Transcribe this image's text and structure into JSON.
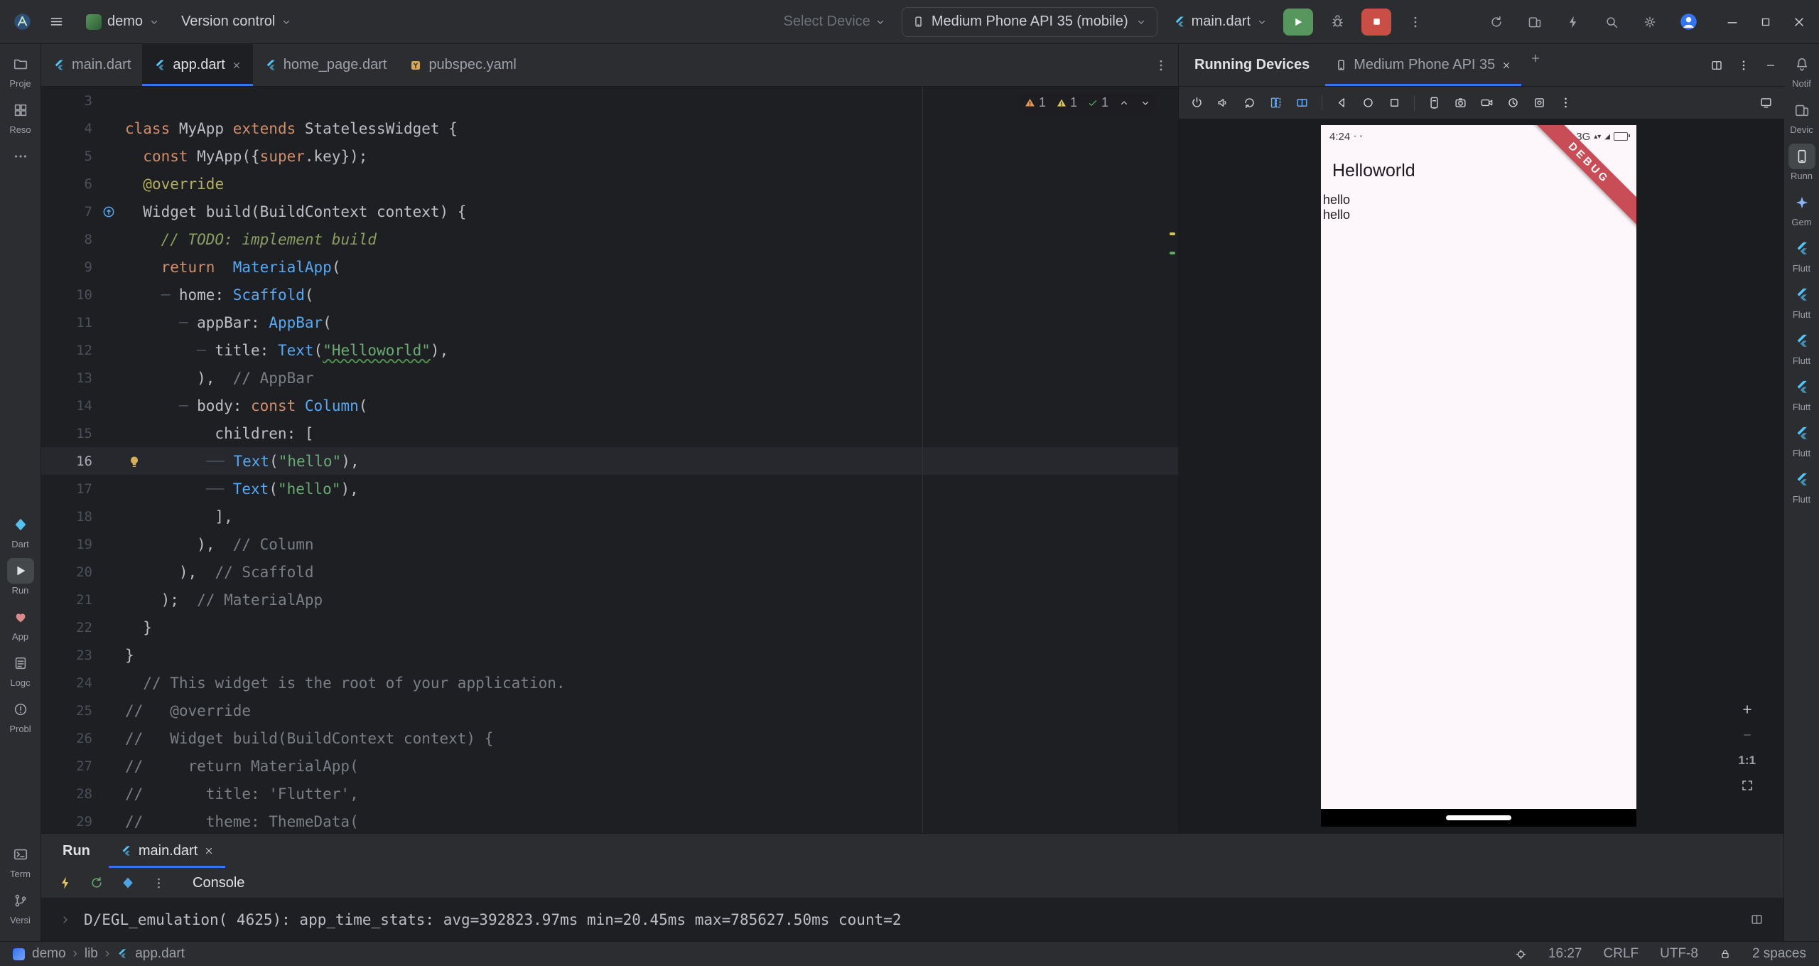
{
  "colors": {
    "accent": "#3574F0",
    "editor_bg": "#1E1F22",
    "panel_bg": "#2B2D30",
    "text": "#BCBEC4",
    "dim_text": "#9DA0A8",
    "run_green": "#57965C",
    "stop_red": "#C94F46",
    "keyword_orange": "#CF8E6D",
    "type_blue": "#56A8F5",
    "string_green": "#6AAB73",
    "comment_grey": "#7A7E85",
    "todo_green": "#8C9E62",
    "annotation_yellow": "#B3AE60",
    "guide_grey": "#494F57",
    "current_line": "#26282E",
    "phone_bg": "#FDF6FA",
    "phone_text": "#1D1B20",
    "banner_red": "#C6414B",
    "flutter_blue": "#54C5F8",
    "warning_amber": "#E3985C",
    "warning_yellow": "#D9C35A",
    "ok_green": "#5FAD65"
  },
  "title_bar": {
    "project": "demo",
    "vcs": "Version control",
    "select_device": "Select Device",
    "device": "Medium Phone API 35 (mobile)",
    "run_config": "main.dart"
  },
  "left_strip": {
    "groups": [
      [
        {
          "id": "project",
          "icon": "folder",
          "label": "Proje"
        },
        {
          "id": "resource-manager",
          "icon": "grid",
          "label": "Reso"
        },
        {
          "id": "more-tool-windows",
          "icon": "more-h",
          "label": ""
        }
      ],
      [
        {
          "id": "dart-analysis",
          "icon": "dart",
          "label": "Dart",
          "color": "#55c1f0"
        },
        {
          "id": "run",
          "icon": "play",
          "label": "Run",
          "selected": true
        },
        {
          "id": "app-quality-insights",
          "icon": "heart",
          "label": "App",
          "color": "#d98a8a"
        },
        {
          "id": "logcat",
          "icon": "logdoc",
          "label": "Logc"
        },
        {
          "id": "problems",
          "icon": "warning-circle",
          "label": "Probl"
        }
      ],
      [
        {
          "id": "terminal",
          "icon": "terminal",
          "label": "Term"
        },
        {
          "id": "version-control",
          "icon": "branch",
          "label": "Versi"
        }
      ]
    ]
  },
  "right_strip": {
    "groups": [
      [
        {
          "id": "notifications",
          "icon": "bell",
          "label": "Notif"
        },
        {
          "id": "device-manager",
          "icon": "devices",
          "label": "Devic"
        },
        {
          "id": "running-devices",
          "icon": "phone",
          "label": "Runn",
          "selected": true
        },
        {
          "id": "gemini",
          "icon": "star4",
          "label": "Gem",
          "color": "#8ab4f8"
        },
        {
          "id": "flutter-tool-1",
          "icon": "flutter",
          "label": "Flutt",
          "color": "#54c5f8"
        },
        {
          "id": "flutter-tool-2",
          "icon": "flutter",
          "label": "Flutt",
          "color": "#54c5f8"
        },
        {
          "id": "flutter-tool-3",
          "icon": "flutter",
          "label": "Flutt",
          "color": "#54c5f8"
        },
        {
          "id": "flutter-tool-4",
          "icon": "flutter",
          "label": "Flutt",
          "color": "#54c5f8"
        },
        {
          "id": "flutter-tool-5",
          "icon": "flutter",
          "label": "Flutt",
          "color": "#54c5f8"
        },
        {
          "id": "flutter-tool-6",
          "icon": "flutter",
          "label": "Flutt",
          "color": "#54c5f8"
        }
      ]
    ]
  },
  "editor": {
    "tabs": [
      {
        "label": "main.dart",
        "icon": "flutter"
      },
      {
        "label": "app.dart",
        "icon": "flutter",
        "active": true,
        "close": true
      },
      {
        "label": "home_page.dart",
        "icon": "flutter"
      },
      {
        "label": "pubspec.yaml",
        "icon": "yaml"
      }
    ],
    "inspections": [
      {
        "type": "warning-amber",
        "count": "1"
      },
      {
        "type": "warning-yellow",
        "count": "1"
      },
      {
        "type": "ok",
        "count": "1"
      }
    ],
    "lines": [
      {
        "n": "3",
        "segs": []
      },
      {
        "n": "4",
        "segs": [
          [
            "kw",
            "class"
          ],
          [
            "pl",
            " MyApp "
          ],
          [
            "kw",
            "extends"
          ],
          [
            "pl",
            " StatelessWidget {"
          ]
        ]
      },
      {
        "n": "5",
        "segs": [
          [
            "pl",
            "  "
          ],
          [
            "kw",
            "const"
          ],
          [
            "pl",
            " MyApp({"
          ],
          [
            "kw",
            "super"
          ],
          [
            "pl",
            ".key});"
          ]
        ]
      },
      {
        "n": "6",
        "segs": [
          [
            "pl",
            "  "
          ],
          [
            "an",
            "@override"
          ]
        ]
      },
      {
        "n": "7",
        "gutter": "override",
        "segs": [
          [
            "pl",
            "  Widget build(BuildContext context) {"
          ]
        ]
      },
      {
        "n": "8",
        "segs": [
          [
            "pl",
            "    "
          ],
          [
            "td",
            "// TODO: implement build"
          ]
        ]
      },
      {
        "n": "9",
        "segs": [
          [
            "pl",
            "    "
          ],
          [
            "kw",
            "return"
          ],
          [
            "pl",
            "  "
          ],
          [
            "ty",
            "MaterialApp"
          ],
          [
            "pl",
            "("
          ]
        ]
      },
      {
        "n": "10",
        "segs": [
          [
            "pl",
            "    "
          ],
          [
            "gd",
            "─ "
          ],
          [
            "pl",
            "home: "
          ],
          [
            "ty",
            "Scaffold"
          ],
          [
            "pl",
            "("
          ]
        ]
      },
      {
        "n": "11",
        "segs": [
          [
            "pl",
            "      "
          ],
          [
            "gd",
            "─ "
          ],
          [
            "pl",
            "appBar: "
          ],
          [
            "ty",
            "AppBar"
          ],
          [
            "pl",
            "("
          ]
        ]
      },
      {
        "n": "12",
        "segs": [
          [
            "pl",
            "        "
          ],
          [
            "gd",
            "─ "
          ],
          [
            "pl",
            "title: "
          ],
          [
            "ty",
            "Text"
          ],
          [
            "pl",
            "("
          ],
          [
            "sw",
            "\"Helloworld\""
          ],
          [
            "pl",
            "),"
          ]
        ]
      },
      {
        "n": "13",
        "segs": [
          [
            "pl",
            "        ),  "
          ],
          [
            "cm",
            "// AppBar"
          ]
        ]
      },
      {
        "n": "14",
        "segs": [
          [
            "pl",
            "      "
          ],
          [
            "gd",
            "─ "
          ],
          [
            "pl",
            "body: "
          ],
          [
            "kw",
            "const"
          ],
          [
            "pl",
            " "
          ],
          [
            "ty",
            "Column"
          ],
          [
            "pl",
            "("
          ]
        ]
      },
      {
        "n": "15",
        "segs": [
          [
            "pl",
            "          children: ["
          ]
        ]
      },
      {
        "n": "16",
        "current": true,
        "segs": [
          {
            "i": "bulb"
          },
          [
            "pl",
            "       "
          ],
          [
            "gd",
            "── "
          ],
          [
            "ty",
            "Text"
          ],
          [
            "pl",
            "("
          ],
          [
            "st",
            "\"hello\""
          ],
          [
            "pl",
            "),"
          ]
        ]
      },
      {
        "n": "17",
        "segs": [
          [
            "pl",
            "         "
          ],
          [
            "gd",
            "── "
          ],
          [
            "ty",
            "Text"
          ],
          [
            "pl",
            "("
          ],
          [
            "st",
            "\"hello\""
          ],
          [
            "pl",
            "),"
          ]
        ]
      },
      {
        "n": "18",
        "segs": [
          [
            "pl",
            "          ],"
          ]
        ]
      },
      {
        "n": "19",
        "segs": [
          [
            "pl",
            "        ),  "
          ],
          [
            "cm",
            "// Column"
          ]
        ]
      },
      {
        "n": "20",
        "segs": [
          [
            "pl",
            "      ),  "
          ],
          [
            "cm",
            "// Scaffold"
          ]
        ]
      },
      {
        "n": "21",
        "segs": [
          [
            "pl",
            "    );  "
          ],
          [
            "cm",
            "// MaterialApp"
          ]
        ]
      },
      {
        "n": "22",
        "segs": [
          [
            "pl",
            "  }"
          ]
        ]
      },
      {
        "n": "23",
        "segs": [
          [
            "pl",
            "}"
          ]
        ]
      },
      {
        "n": "24",
        "segs": [
          [
            "pl",
            "  "
          ],
          [
            "cm",
            "// This widget is the root of your application."
          ]
        ]
      },
      {
        "n": "25",
        "segs": [
          [
            "cm",
            "//   @override"
          ]
        ]
      },
      {
        "n": "26",
        "segs": [
          [
            "cm",
            "//   Widget build(BuildContext context) {"
          ]
        ]
      },
      {
        "n": "27",
        "segs": [
          [
            "cm",
            "//     return MaterialApp("
          ]
        ]
      },
      {
        "n": "28",
        "segs": [
          [
            "cm",
            "//       title: 'Flutter',"
          ]
        ]
      },
      {
        "n": "29",
        "segs": [
          [
            "cm",
            "//       theme: ThemeData("
          ]
        ]
      }
    ]
  },
  "device_panel": {
    "title": "Running Devices",
    "tab_label": "Medium Phone API 35",
    "zoom_reset": "1:1",
    "toolbar": [
      {
        "icon": "power",
        "name": "power-button"
      },
      {
        "icon": "speaker",
        "name": "volume-button"
      },
      {
        "icon": "rotate",
        "name": "rotate-button"
      },
      {
        "icon": "fold1",
        "name": "fold-button",
        "accent": true
      },
      {
        "icon": "fold2",
        "name": "posture-button",
        "accent": true
      },
      {
        "sep": true
      },
      {
        "icon": "back",
        "name": "back-button"
      },
      {
        "icon": "circle",
        "name": "home-button"
      },
      {
        "icon": "square",
        "name": "overview-button"
      },
      {
        "sep": true
      },
      {
        "icon": "screenshot",
        "name": "screenshot-button"
      },
      {
        "icon": "camera",
        "name": "camera-button"
      },
      {
        "icon": "video",
        "name": "record-button"
      },
      {
        "icon": "history",
        "name": "snapshots-button"
      },
      {
        "icon": "snapshot",
        "name": "settings-button"
      },
      {
        "icon": "more-vert",
        "name": "more-button"
      }
    ],
    "phone": {
      "time": "4:24",
      "network": "3G",
      "banner": "DEBUG",
      "app_title": "Helloworld",
      "body_lines": [
        "hello",
        "hello"
      ]
    }
  },
  "run_panel": {
    "title": "Run",
    "tab": "main.dart",
    "console_label": "Console",
    "console_line": "D/EGL_emulation( 4625): app_time_stats: avg=392823.97ms min=20.45ms max=785627.50ms count=2"
  },
  "status_bar": {
    "breadcrumbs": [
      "demo",
      "lib",
      "app.dart"
    ],
    "position": "16:27",
    "line_ending": "CRLF",
    "encoding": "UTF-8",
    "indent": "2 spaces"
  }
}
